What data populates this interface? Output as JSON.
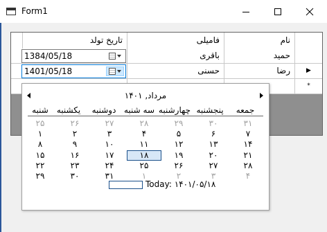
{
  "window": {
    "title": "Form1"
  },
  "grid": {
    "columns": [
      "نام",
      "فامیلی",
      "تاریخ تولد"
    ],
    "rows": [
      {
        "first_name": "حمید",
        "last_name": "باقری",
        "birth_date": "1384/05/18"
      },
      {
        "first_name": "رضا",
        "last_name": "حسنی",
        "birth_date": "1401/05/18"
      }
    ],
    "current_row_marker": "▶",
    "new_row_marker": "*"
  },
  "calendar": {
    "header": "مرداد, ۱۴۰۱",
    "weekdays": [
      "جمعه",
      "پنجشنبه",
      "چهارشنبه",
      "سه شنبه",
      "دوشنبه",
      "یکشنبه",
      "شنبه"
    ],
    "weeks": [
      [
        "۳۱",
        "۳۰",
        "۲۹",
        "۲۸",
        "۲۷",
        "۲۶",
        "۲۵"
      ],
      [
        "۷",
        "۶",
        "۵",
        "۴",
        "۳",
        "۲",
        "۱"
      ],
      [
        "۱۴",
        "۱۳",
        "۱۲",
        "۱۱",
        "۱۰",
        "۹",
        "۸"
      ],
      [
        "۲۱",
        "۲۰",
        "۱۹",
        "۱۸",
        "۱۷",
        "۱۶",
        "۱۵"
      ],
      [
        "۲۸",
        "۲۷",
        "۲۶",
        "۲۵",
        "۲۴",
        "۲۳",
        "۲۲"
      ],
      [
        "۴",
        "۳",
        "۲",
        "۱",
        "۳۱",
        "۳۰",
        "۲۹"
      ]
    ],
    "selected_day": "۱۸",
    "today_label": "Today: ۱۴۰۱/۰۵/۱۸"
  }
}
